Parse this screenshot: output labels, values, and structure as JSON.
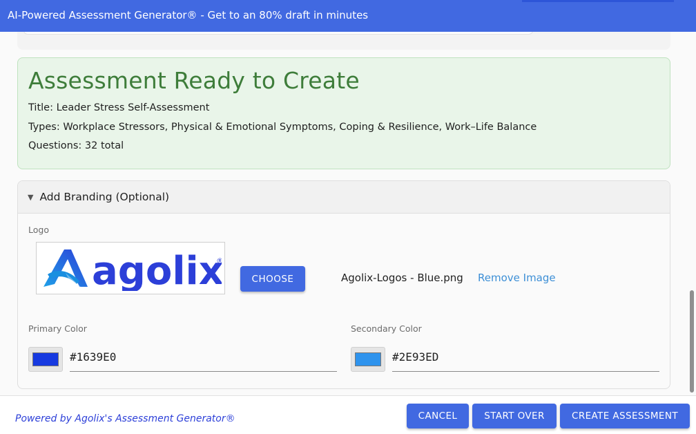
{
  "window": {
    "title": "AI-Powered Assessment Generator® - Get to an 80% draft in minutes"
  },
  "ready": {
    "heading": "Assessment Ready to Create",
    "title_line": "Title: Leader Stress Self-Assessment",
    "types_line": "Types: Workplace Stressors, Physical & Emotional Symptoms, Coping & Resilience, Work–Life Balance",
    "questions_line": "Questions: 32 total"
  },
  "branding": {
    "toggle_icon": "▼",
    "header": "Add Branding (Optional)",
    "logo_label": "Logo",
    "logo_text": "agolix",
    "logo_mark": "®",
    "choose_label": "CHOOSE",
    "file_name": "Agolix-Logos - Blue.png",
    "remove_label": "Remove Image",
    "primary": {
      "label": "Primary Color",
      "value": "#1639E0"
    },
    "secondary": {
      "label": "Secondary Color",
      "value": "#2E93ED"
    }
  },
  "footer": {
    "powered_by": "Powered by Agolix's Assessment Generator®",
    "cancel_label": "CANCEL",
    "start_over_label": "START OVER",
    "create_label": "CREATE ASSESSMENT"
  },
  "colors": {
    "accent": "#4169E1",
    "success_bg": "#E9F5E9",
    "success_text": "#3E7D3A",
    "link": "#3D8FD6",
    "logo_blue": "#2C3FD8"
  }
}
